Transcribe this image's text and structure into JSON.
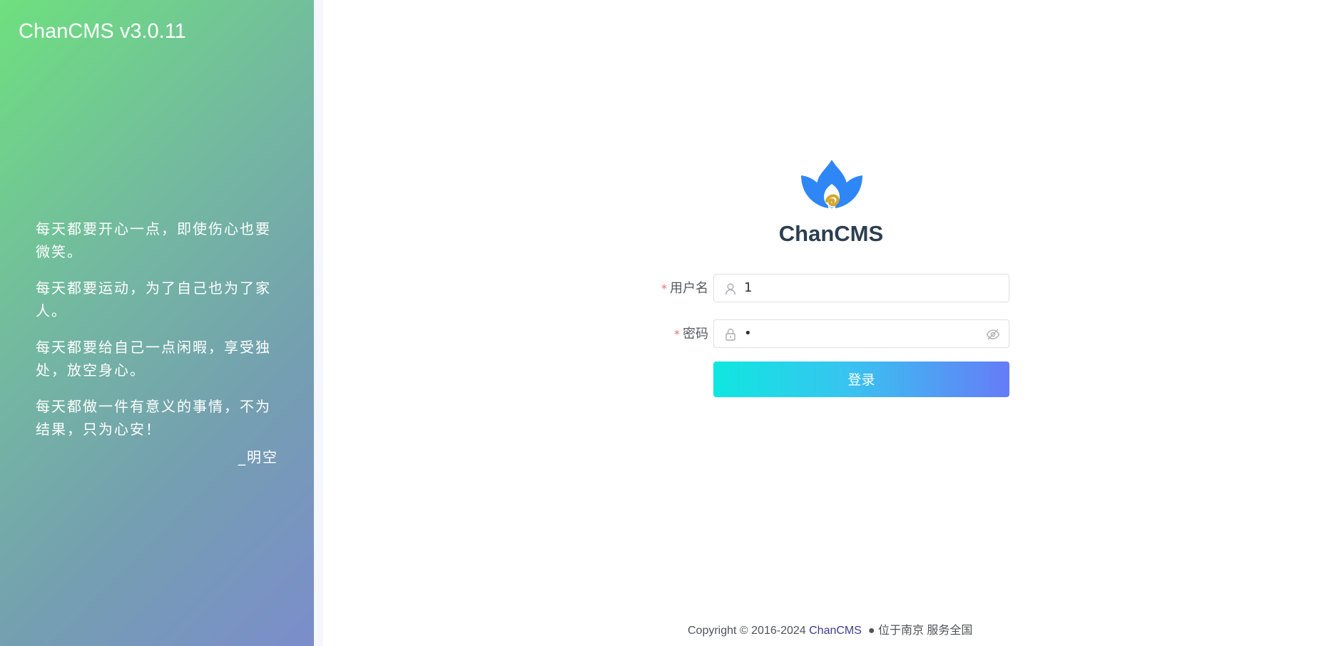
{
  "sidebar": {
    "title": "ChanCMS v3.0.11",
    "quotes": [
      "每天都要开心一点，即使伤心也要微笑。",
      "每天都要运动，为了自己也为了家人。",
      "每天都要给自己一点闲暇，享受独处，放空身心。",
      "每天都做一件有意义的事情，不为结果，只为心安！"
    ],
    "author": "_明空"
  },
  "login": {
    "app_name": "ChanCMS",
    "username": {
      "label": "用户名",
      "required_mark": "*",
      "value": "1",
      "icon": "user-icon"
    },
    "password": {
      "label": "密码",
      "required_mark": "*",
      "value": "•",
      "icon": "lock-icon",
      "toggle_icon": "eye-off-icon"
    },
    "submit_label": "登录"
  },
  "footer": {
    "copyright": "Copyright © 2016-2024 ",
    "brand": "ChanCMS",
    "location": "  ● 位于南京 服务全国"
  },
  "colors": {
    "sidebar_gradient_start": "#6ee07e",
    "sidebar_gradient_end": "#7b8dcb",
    "logo_blue": "#2f86f6",
    "logo_gold": "#d4a62a",
    "button_gradient_start": "#0fe7e0",
    "button_gradient_end": "#657cf7",
    "required": "#f56c6c"
  }
}
